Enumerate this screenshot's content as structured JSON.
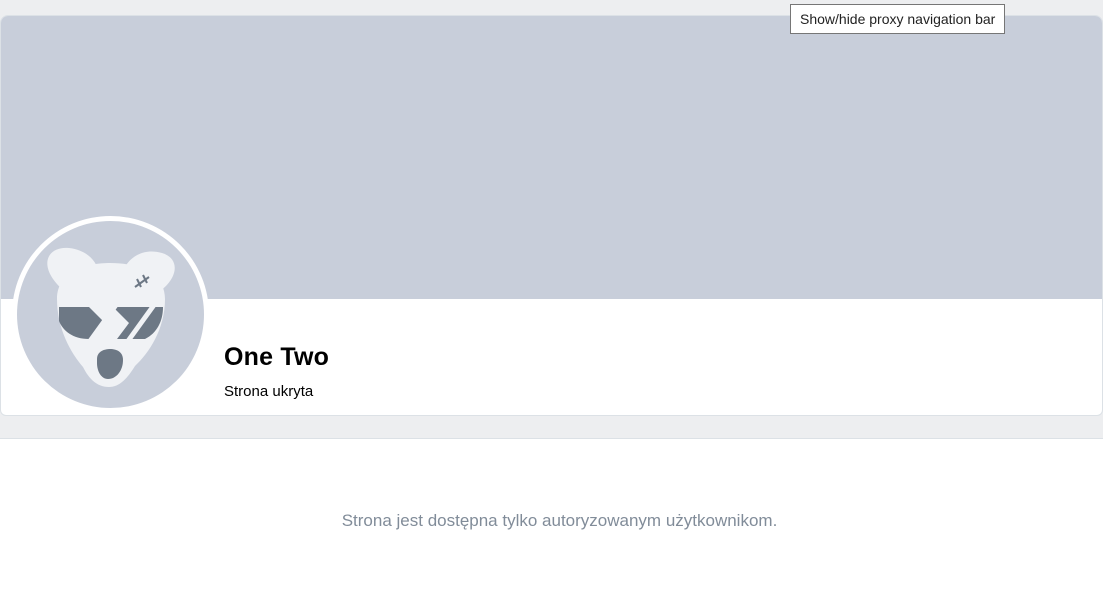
{
  "profile": {
    "name": "One Two",
    "status": "Strona ukryta",
    "avatar_icon": "deactivated-dog-avatar-icon"
  },
  "content": {
    "message": "Strona jest dostępna tylko autoryzowanym użytkownikom."
  },
  "tooltip": {
    "text": "Show/hide proxy navigation bar"
  },
  "colors": {
    "page_background": "#edeef0",
    "cover": "#c8ceda",
    "message_text": "#818c99",
    "avatar_face": "#f0f2f5",
    "avatar_dark": "#6d7885"
  }
}
